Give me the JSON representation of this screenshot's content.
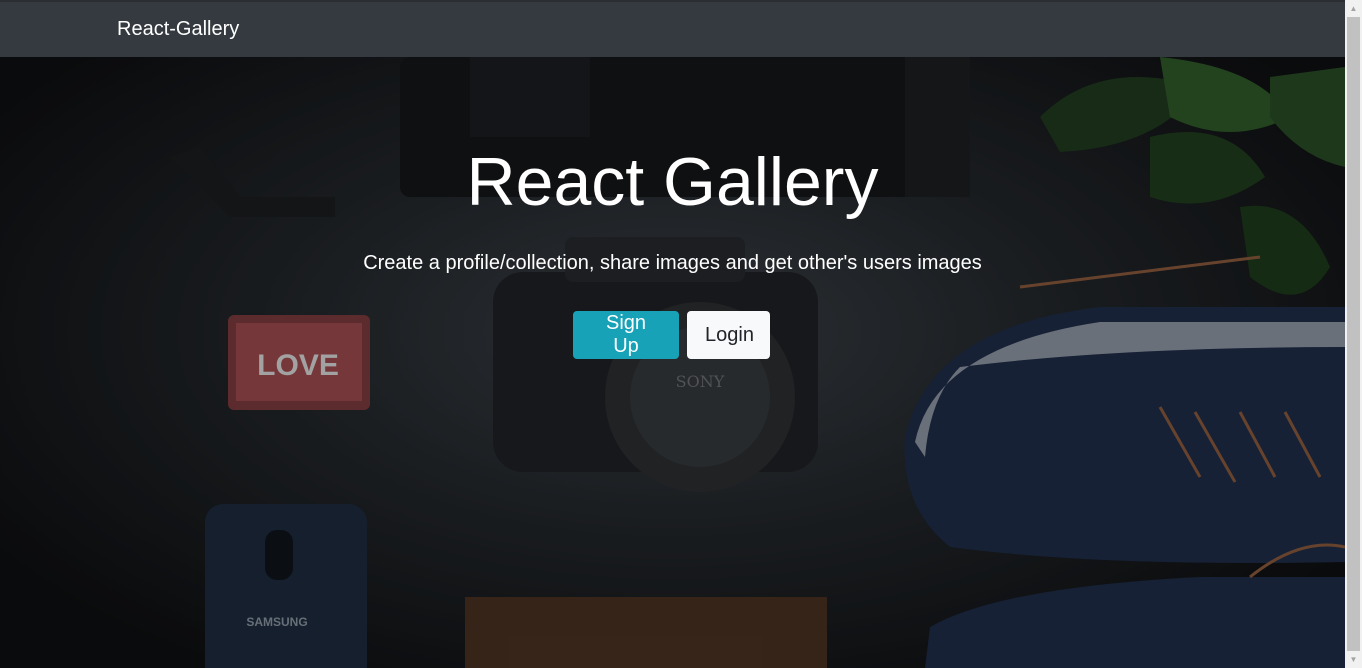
{
  "navbar": {
    "brand": "React-Gallery"
  },
  "hero": {
    "title": "React Gallery",
    "subtitle": "Create a profile/collection, share images and get other's users images",
    "buttons": {
      "signup": "Sign Up",
      "login": "Login"
    },
    "image_labels": {
      "camera_brand": "SONY",
      "phone_brand": "SAMSUNG",
      "lighter_text": "LOVE"
    }
  },
  "scrollbar": {
    "up_arrow": "▲",
    "down_arrow": "▼"
  },
  "colors": {
    "navbar": "#343a40",
    "primary_button": "#17a2b8",
    "light_button": "#f8f9fa"
  }
}
